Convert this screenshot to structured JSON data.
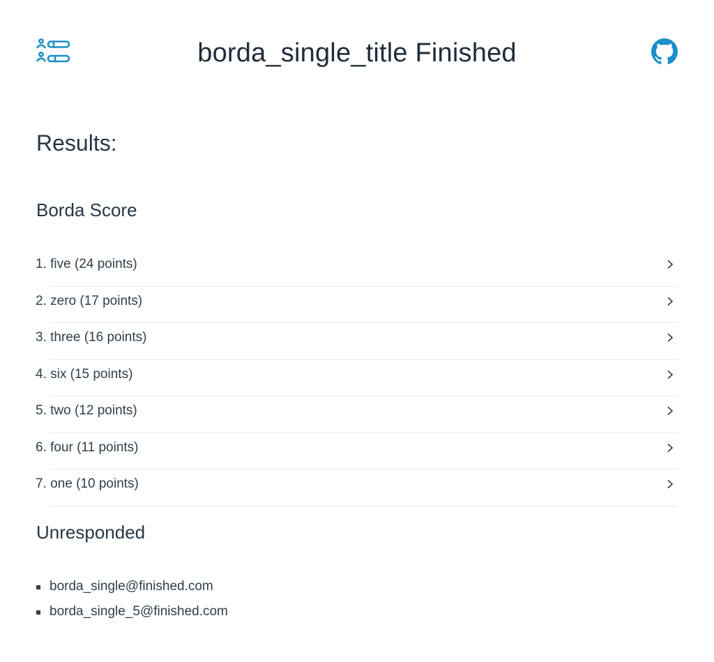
{
  "header": {
    "title": "borda_single_title Finished",
    "logo_icon": "poll-app-logo-icon",
    "github_icon": "github-icon"
  },
  "results": {
    "title": "Results:"
  },
  "borda": {
    "title": "Borda Score",
    "items": [
      {
        "label": "1. five (24 points)"
      },
      {
        "label": "2. zero (17 points)"
      },
      {
        "label": "3. three (16 points)"
      },
      {
        "label": "4. six (15 points)"
      },
      {
        "label": "5. two (12 points)"
      },
      {
        "label": "6. four (11 points)"
      },
      {
        "label": "7. one (10 points)"
      }
    ]
  },
  "unresponded": {
    "title": "Unresponded",
    "items": [
      {
        "email": "borda_single@finished.com"
      },
      {
        "email": "borda_single_5@finished.com"
      }
    ]
  },
  "colors": {
    "accent": "#1b8fc9",
    "text": "#2a3947",
    "divider": "#e6e9ec"
  }
}
